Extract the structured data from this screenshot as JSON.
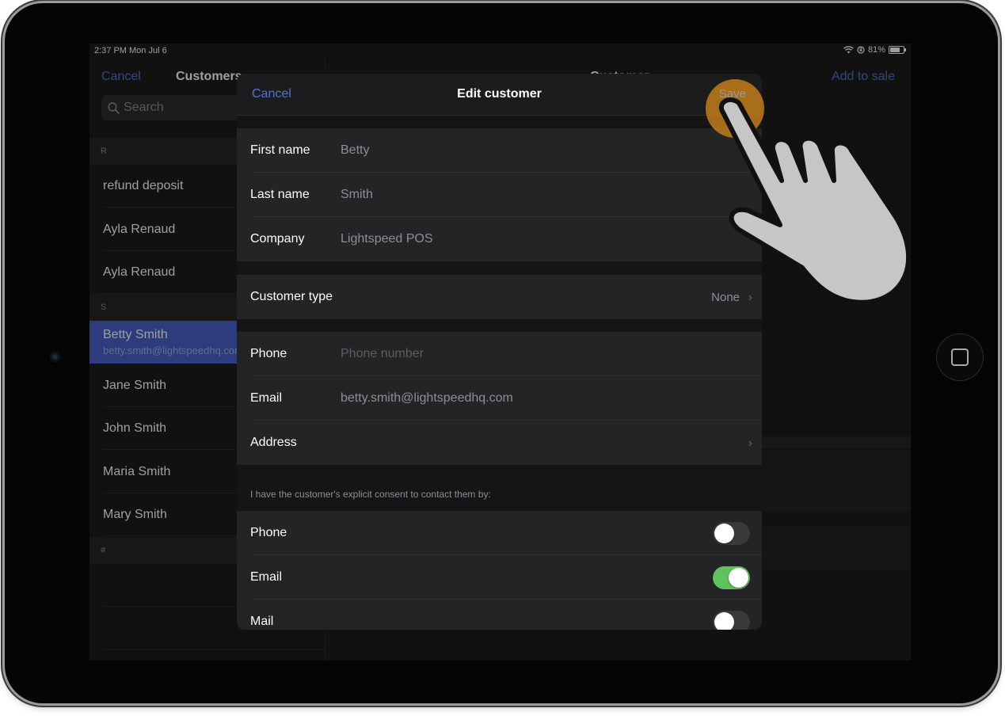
{
  "status_bar": {
    "time": "2:37 PM  Mon Jul 6",
    "battery": "81%"
  },
  "customers_panel": {
    "cancel": "Cancel",
    "title": "Customers",
    "search_placeholder": "Search",
    "sections": [
      {
        "letter": "R",
        "items": [
          {
            "name": "refund deposit"
          },
          {
            "name": "Ayla Renaud"
          },
          {
            "name": "Ayla Renaud"
          }
        ]
      },
      {
        "letter": "S",
        "items": [
          {
            "name": "Betty Smith",
            "email": "betty.smith@lightspeedhq.com",
            "selected": true
          },
          {
            "name": "Jane Smith"
          },
          {
            "name": "John Smith"
          },
          {
            "name": "Maria Smith"
          },
          {
            "name": "Mary Smith"
          }
        ]
      },
      {
        "letter": "#",
        "items": []
      }
    ]
  },
  "detail_panel": {
    "title": "Customer",
    "add_to_sale": "Add to sale"
  },
  "edit_modal": {
    "cancel": "Cancel",
    "title": "Edit customer",
    "save": "Save",
    "first_name_label": "First name",
    "first_name_value": "Betty",
    "last_name_label": "Last name",
    "last_name_value": "Smith",
    "company_label": "Company",
    "company_value": "Lightspeed POS",
    "customer_type_label": "Customer type",
    "customer_type_value": "None",
    "phone_label": "Phone",
    "phone_placeholder": "Phone number",
    "email_label": "Email",
    "email_value": "betty.smith@lightspeedhq.com",
    "address_label": "Address",
    "consent_note": "I have the customer's explicit consent to contact them by:",
    "consent_phone_label": "Phone",
    "consent_phone_on": false,
    "consent_email_label": "Email",
    "consent_email_on": true,
    "consent_mail_label": "Mail",
    "consent_mail_on": false
  },
  "colors": {
    "accent": "#5a72c6",
    "selected_row": "#4a62c9",
    "toggle_on": "#5fc35c",
    "tap_highlight": "#c7801a"
  },
  "icons": [
    "search-icon",
    "wifi-icon",
    "orientation-lock-icon",
    "battery-icon",
    "chevron-right-icon",
    "hand-pointer-icon",
    "home-button-icon"
  ]
}
